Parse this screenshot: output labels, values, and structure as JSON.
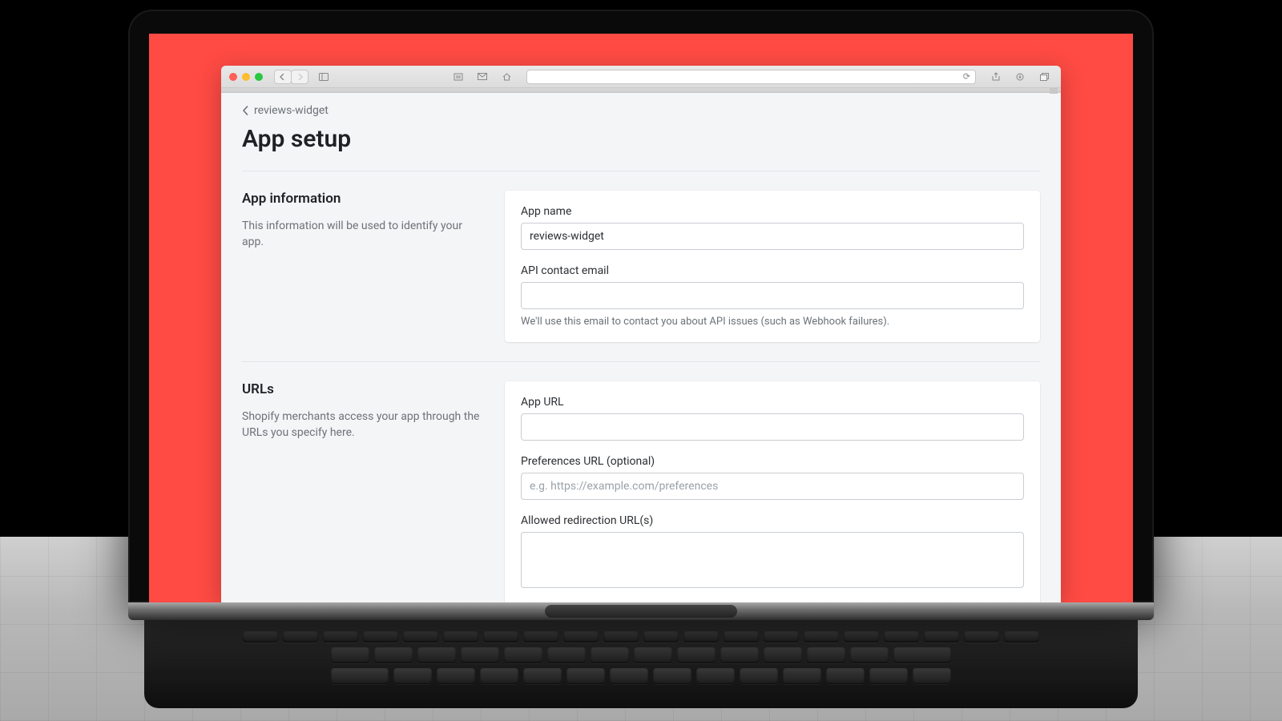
{
  "breadcrumb": {
    "label": "reviews-widget"
  },
  "page": {
    "title": "App setup"
  },
  "sections": {
    "app_info": {
      "heading": "App information",
      "description": "This information will be used to identify your app.",
      "app_name_label": "App name",
      "app_name_value": "reviews-widget",
      "email_label": "API contact email",
      "email_value": "",
      "email_help": "We'll use this email to contact you about API issues (such as Webhook failures)."
    },
    "urls": {
      "heading": "URLs",
      "description": "Shopify merchants access your app through the URLs you specify here.",
      "app_url_label": "App URL",
      "app_url_value": "",
      "prefs_label": "Preferences URL (optional)",
      "prefs_value": "",
      "prefs_placeholder": "e.g. https://example.com/preferences",
      "redirect_label": "Allowed redirection URL(s)",
      "redirect_value": ""
    }
  }
}
